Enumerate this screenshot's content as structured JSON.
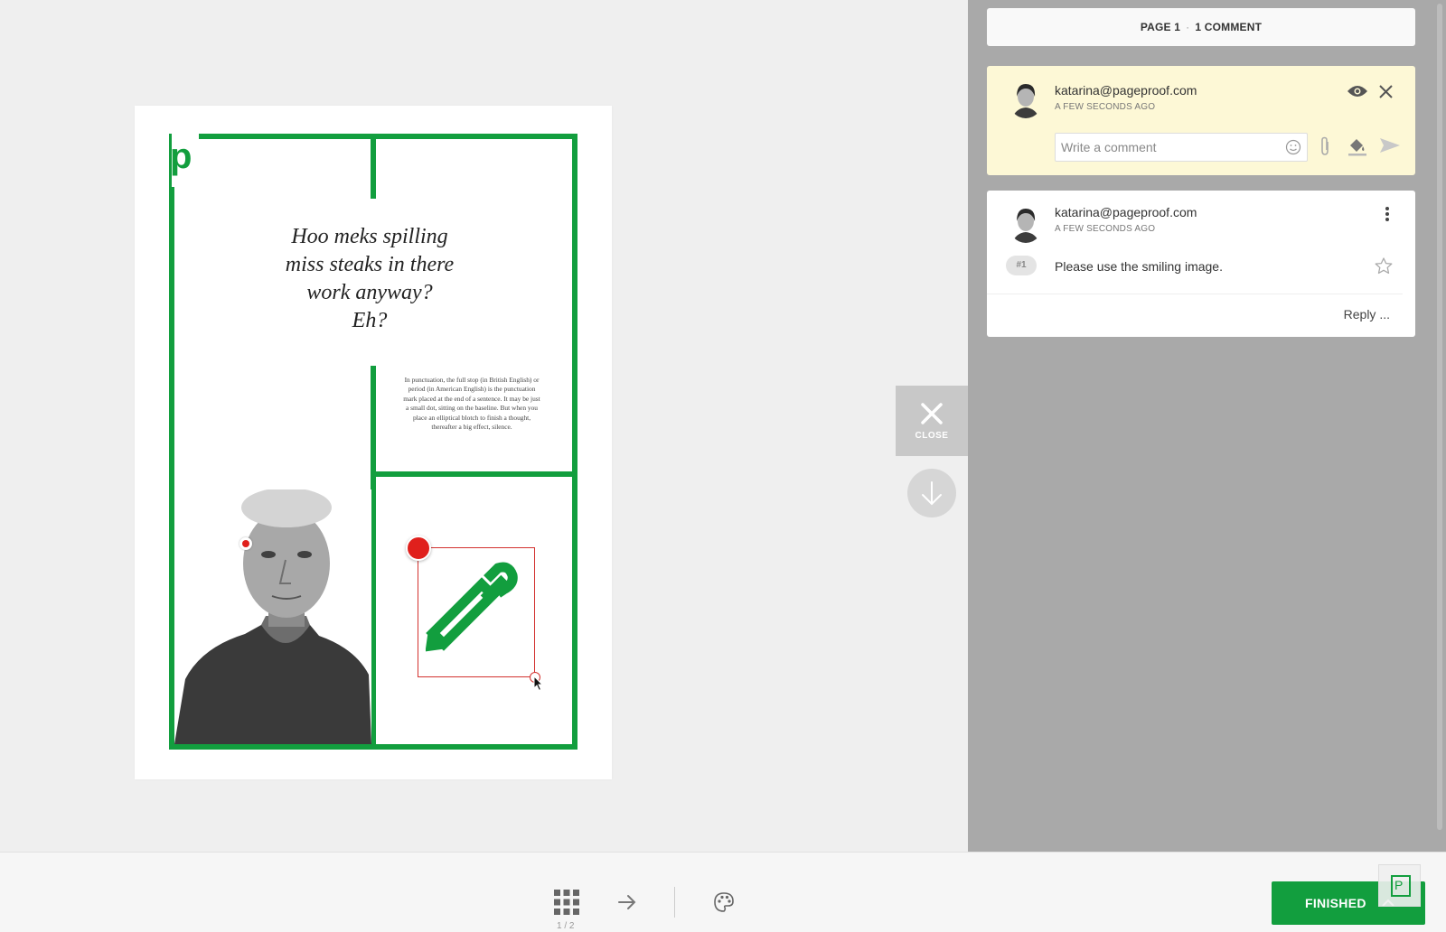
{
  "proof": {
    "logo_letter": "p",
    "headline": "Hoo meks spilling\nmiss steaks in there\nwork anyway?\nEh?",
    "body_copy": "In punctuation, the full stop (in British English) or period (in American English) is the punctuation mark placed at the end of a sentence. It may be just a small dot, sitting on the baseline. But when you place an elliptical blotch to finish a thought, thereafter a big effect, silence.",
    "accent_color": "#129e3e",
    "annotation_color": "#e0201c"
  },
  "side_controls": {
    "close_label": "CLOSE"
  },
  "panel": {
    "page_label": "PAGE 1",
    "comment_count": "1 COMMENT",
    "draft": {
      "author": "katarina@pageproof.com",
      "timestamp": "A FEW SECONDS AGO",
      "placeholder": "Write a comment"
    },
    "comment": {
      "author": "katarina@pageproof.com",
      "timestamp": "A FEW SECONDS AGO",
      "number": "#1",
      "text": "Please use the smiling image.",
      "reply_label": "Reply ..."
    }
  },
  "bottom_bar": {
    "page_counter": "1 / 2",
    "finished_label": "FINISHED",
    "badge_letter": "P"
  },
  "icons": [
    "grid-icon",
    "arrow-right-icon",
    "palette-icon",
    "eye-icon",
    "close-icon",
    "smiley-icon",
    "paperclip-icon",
    "paint-bucket-icon",
    "send-icon",
    "more-vertical-icon",
    "star-icon",
    "arrow-down-icon",
    "pencil-logo-icon"
  ]
}
